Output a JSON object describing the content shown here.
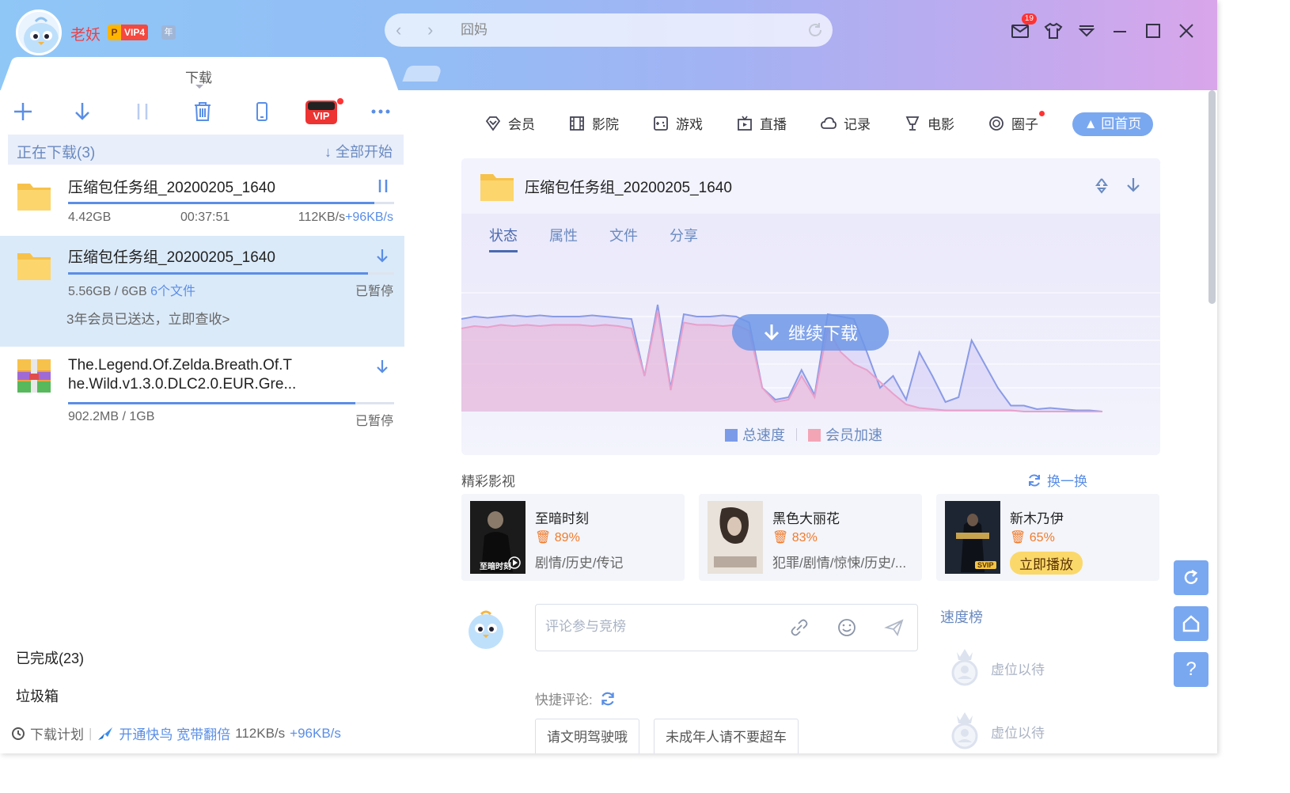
{
  "header": {
    "username": "老妖",
    "vip_p": "P",
    "vip_label": "VIP4",
    "vip_year": "年",
    "search_value": "",
    "search_placeholder": "囧妈",
    "mail_count": "19"
  },
  "tabs": {
    "download": "下载"
  },
  "toolbar": {
    "vip_label": "VIP"
  },
  "downloading": {
    "title": "正在下载(3)",
    "start_all": "全部开始",
    "tasks": [
      {
        "name": "压缩包任务组_20200205_1640",
        "size": "4.42GB",
        "time": "00:37:51",
        "speed": "112KB/s",
        "boost": "+96KB/s",
        "progress": 0.94
      },
      {
        "name": "压缩包任务组_20200205_1640",
        "size": "5.56GB / 6GB",
        "files": "6个文件",
        "status": "已暂停",
        "promo": "3年会员已送达，立即查收>",
        "progress": 0.92
      },
      {
        "name_line1": "The.Legend.Of.Zelda.Breath.Of.T",
        "name_line2": "he.Wild.v1.3.0.DLC2.0.EUR.Gre...",
        "size": "902.2MB / 1GB",
        "status": "已暂停",
        "progress": 0.88
      }
    ]
  },
  "sidebar": {
    "completed": "已完成(23)",
    "trash": "垃圾箱"
  },
  "footer": {
    "plan": "下载计划",
    "promo": "开通快鸟 宽带翻倍",
    "speed": "112KB/s",
    "boost": "+96KB/s"
  },
  "topnav": [
    "会员",
    "影院",
    "游戏",
    "直播",
    "记录",
    "电影",
    "圈子"
  ],
  "home_button": "回首页",
  "detail": {
    "title": "压缩包任务组_20200205_1640",
    "subtabs": [
      "状态",
      "属性",
      "文件",
      "分享"
    ],
    "resume": "继续下载",
    "legend": [
      {
        "name": "总速度",
        "color": "#7b9be8"
      },
      {
        "name": "会员加速",
        "color": "#f3a5b6"
      }
    ]
  },
  "chart_data": {
    "type": "area",
    "series": [
      {
        "name": "总速度",
        "values": [
          78,
          80,
          79,
          80,
          81,
          80,
          81,
          80,
          80,
          80,
          81,
          80,
          79,
          78,
          30,
          90,
          20,
          82,
          80,
          80,
          81,
          80,
          75,
          20,
          10,
          12,
          35,
          14,
          82,
          80,
          78,
          50,
          20,
          30,
          10,
          50,
          30,
          8,
          12,
          60,
          40,
          20,
          5,
          5,
          2,
          3,
          2,
          1,
          1,
          0
        ]
      },
      {
        "name": "会员加速",
        "values": [
          70,
          72,
          71,
          73,
          72,
          73,
          72,
          73,
          73,
          73,
          72,
          73,
          72,
          70,
          30,
          85,
          18,
          75,
          73,
          73,
          72,
          73,
          68,
          20,
          8,
          10,
          30,
          12,
          70,
          50,
          40,
          35,
          25,
          15,
          6,
          3,
          2,
          1,
          1,
          1,
          1,
          1,
          1,
          0,
          0,
          0,
          0,
          0,
          0,
          0
        ]
      }
    ]
  },
  "featured": {
    "title": "精彩影视",
    "refresh": "换一换",
    "movies": [
      {
        "title": "至暗时刻",
        "score": "89%",
        "genre": "剧情/历史/传记",
        "poster_text": "至暗时刻"
      },
      {
        "title": "黑色大丽花",
        "score": "83%",
        "genre": "犯罪/剧情/惊悚/历史/..."
      },
      {
        "title": "新木乃伊",
        "score": "65%",
        "play": "立即播放",
        "badge": "SVIP"
      }
    ]
  },
  "comment": {
    "placeholder": "评论参与竞榜",
    "quick_label": "快捷评论:",
    "quick": [
      "请文明驾驶哦",
      "未成年人请不要超车"
    ]
  },
  "rank": {
    "title": "速度榜",
    "items": [
      "虚位以待",
      "虚位以待"
    ]
  }
}
